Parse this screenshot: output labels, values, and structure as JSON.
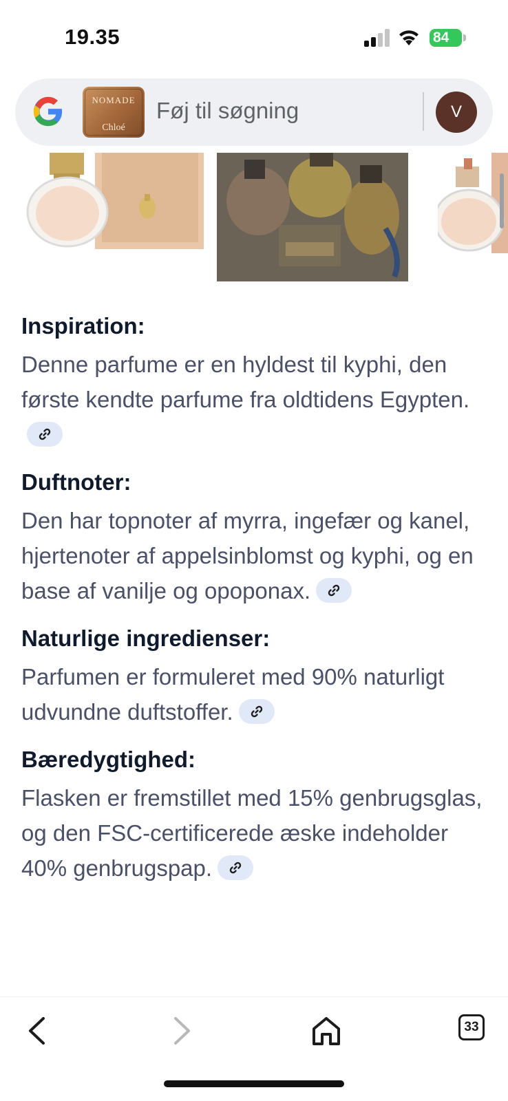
{
  "status_bar": {
    "time": "19.35",
    "battery": "84"
  },
  "search": {
    "placeholder": "Føj til søgning",
    "thumbnail_title": "NOMADE",
    "thumbnail_brand": "Chloé",
    "avatar_initial": "V"
  },
  "sections": [
    {
      "heading": "Inspiration:",
      "body": "Denne parfume er en hyldest til kyphi, den første kendte parfume fra oldtidens Egypten."
    },
    {
      "heading": "Duftnoter:",
      "body": "Den har topnoter af myrra, ingefær og kanel, hjertenoter af appelsinblomst og kyphi, og en base af vanilje og opoponax."
    },
    {
      "heading": "Naturlige ingredienser:",
      "body": "Parfumen er formuleret med 90% naturligt udvundne duftstoffer."
    },
    {
      "heading": "Bæredygtighed:",
      "body": "Flasken er fremstillet med 15% genbrugsglas, og den FSC-certificerede æske indeholder 40% genbrugspap."
    }
  ],
  "bottom_nav": {
    "tab_count": "33",
    "icons": [
      "back-icon",
      "forward-icon",
      "home-icon",
      "tabs-icon"
    ]
  },
  "colors": {
    "heading": "#0f1b2d",
    "body_text": "#4a5068",
    "link_chip": "#e1e8f8",
    "search_bar": "#eef0f3",
    "battery": "#34c759",
    "avatar": "#5a3228"
  }
}
